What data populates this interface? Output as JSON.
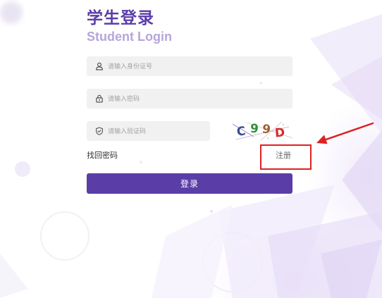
{
  "page": {
    "title": "学生登录",
    "subtitle": "Student Login"
  },
  "form": {
    "id_field": {
      "placeholder": "请输入身份证号",
      "icon": "user-icon"
    },
    "password_field": {
      "placeholder": "请输入密码",
      "icon": "lock-icon"
    },
    "captcha_field": {
      "placeholder": "请输入验证码",
      "icon": "shield-check-icon"
    },
    "captcha": {
      "chars": [
        {
          "char": "C",
          "color": "#3b4a8c"
        },
        {
          "char": "9",
          "color": "#2f8f3a"
        },
        {
          "char": "9",
          "color": "#a0602e"
        },
        {
          "char": "D",
          "color": "#d52a2a"
        }
      ]
    }
  },
  "links": {
    "forgot_password": "找回密码",
    "register": "注册"
  },
  "login_button": {
    "label": "登录"
  },
  "theme": {
    "primary": "#5b3da8",
    "subtitle": "#b6a6d9",
    "annotation": "#e02020"
  }
}
